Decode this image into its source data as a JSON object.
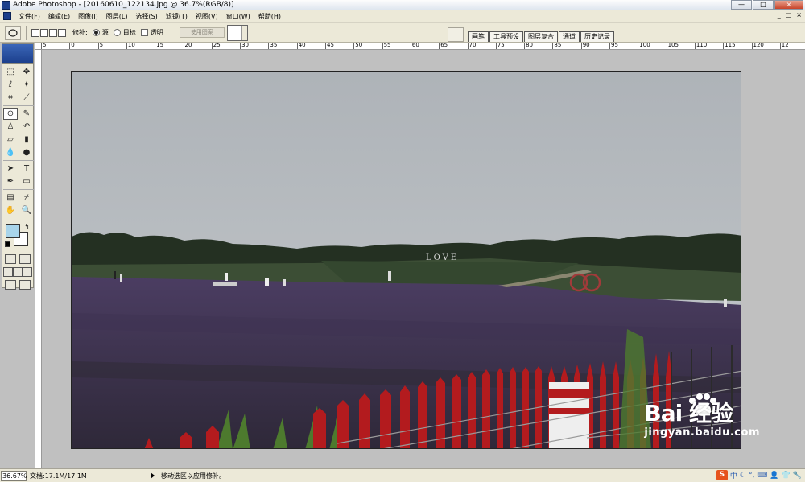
{
  "titlebar": {
    "text": "Adobe Photoshop - [20160610_122134.jpg @ 36.7%(RGB/8)]"
  },
  "window_buttons": [
    "—",
    "□",
    "×"
  ],
  "menu": [
    "文件(F)",
    "编辑(E)",
    "图像(I)",
    "图层(L)",
    "选择(S)",
    "滤镜(T)",
    "视图(V)",
    "窗口(W)",
    "帮助(H)"
  ],
  "mdi_buttons": [
    "_",
    "□",
    "×"
  ],
  "options": {
    "repair_label": "修补:",
    "source_label": "源",
    "target_label": "目标",
    "transparent_label": "透明",
    "use_pattern_label": "使用图案"
  },
  "palette_tabs": [
    "画笔",
    "工具预设",
    "图层复合",
    "通道",
    "历史记录"
  ],
  "ruler_ticks": [
    "5",
    "0",
    "5",
    "10",
    "15",
    "20",
    "25",
    "30",
    "35",
    "40",
    "45",
    "50",
    "55",
    "60",
    "65",
    "70",
    "75",
    "80",
    "85",
    "90",
    "95",
    "100",
    "105",
    "110",
    "115",
    "120",
    "12"
  ],
  "canvas": {
    "love_sign": "LOVE"
  },
  "colors": {
    "foreground": "#a8d4ea",
    "background": "#ffffff"
  },
  "status": {
    "zoom": "36.67%",
    "doc_info": "文档:17.1M/17.1M",
    "message": "移动选区以应用修补。"
  },
  "tray": {
    "ime_icon": "S",
    "lang": "中"
  },
  "watermark": {
    "main": "Bai 经验",
    "sub": "jingyan.baidu.com"
  }
}
